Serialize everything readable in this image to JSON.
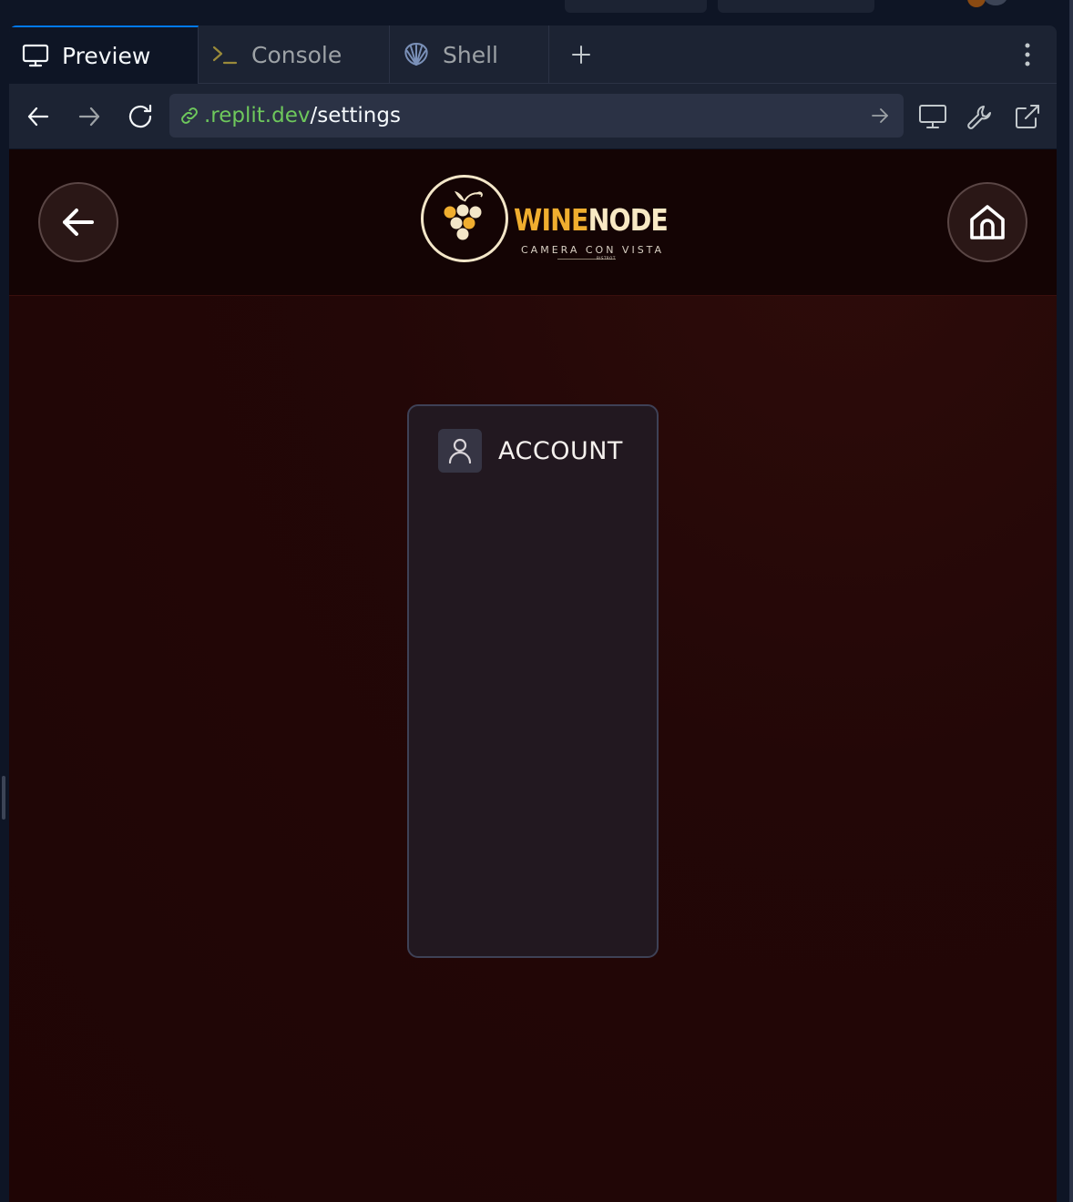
{
  "workspace_tabs": [
    {
      "label": "Preview",
      "icon": "monitor-icon",
      "active": true
    },
    {
      "label": "Console",
      "icon": "terminal-icon",
      "active": false
    },
    {
      "label": "Shell",
      "icon": "shell-icon",
      "active": false
    }
  ],
  "url_bar": {
    "host": ".replit.dev",
    "path": "/settings"
  },
  "app": {
    "brand_primary": "WINE",
    "brand_secondary": "NODE",
    "brand_tagline": "CAMERA CON VISTA",
    "brand_tiny": "BISTROT",
    "back_icon": "arrow-left-icon",
    "home_icon": "home-icon"
  },
  "settings_card": {
    "title": "ACCOUNT",
    "icon": "user-icon"
  },
  "colors": {
    "accent_blue": "#0079f2",
    "url_green": "#6ec85c",
    "brand_gold": "#f0ae2f",
    "brand_cream": "#f8e9c4",
    "app_bg": "#230707"
  }
}
